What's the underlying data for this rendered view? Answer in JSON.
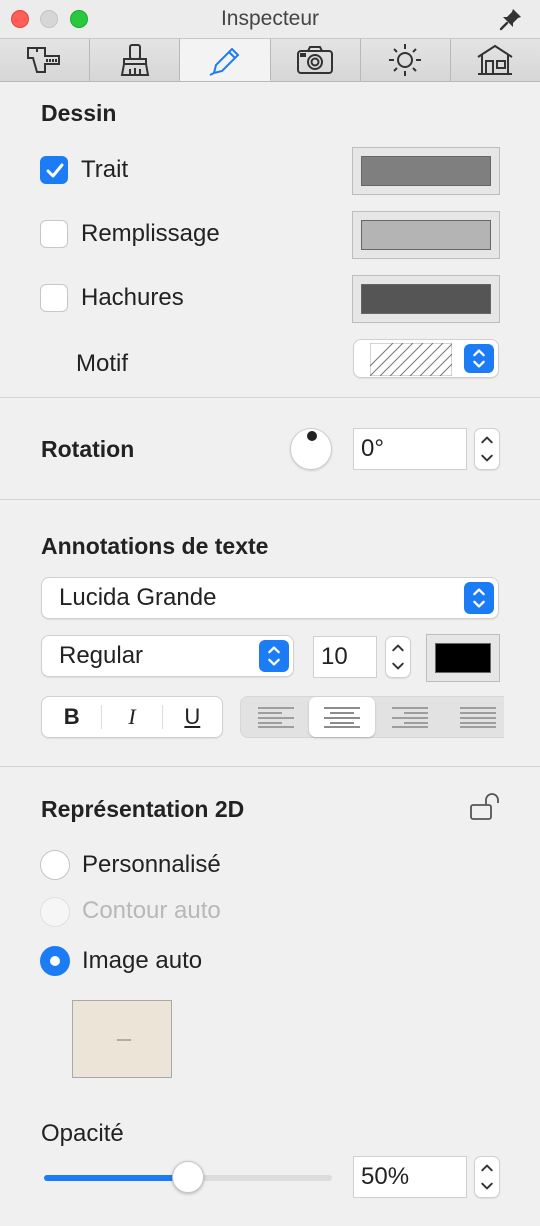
{
  "window": {
    "title": "Inspecteur"
  },
  "tabs": [
    {
      "icon": "caliper-icon",
      "active": false
    },
    {
      "icon": "brush-icon",
      "active": false
    },
    {
      "icon": "pencil-icon",
      "active": true
    },
    {
      "icon": "camera-icon",
      "active": false
    },
    {
      "icon": "sun-icon",
      "active": false
    },
    {
      "icon": "house-icon",
      "active": false
    }
  ],
  "drawing": {
    "title": "Dessin",
    "stroke": {
      "label": "Trait",
      "checked": true,
      "color": "#7f7f7f"
    },
    "fill": {
      "label": "Remplissage",
      "checked": false,
      "color": "#b4b4b4"
    },
    "hatch": {
      "label": "Hachures",
      "checked": false,
      "color": "#555555"
    },
    "pattern_label": "Motif"
  },
  "rotation": {
    "title": "Rotation",
    "value": "0°"
  },
  "text_annotations": {
    "title": "Annotations de texte",
    "font_family": "Lucida Grande",
    "font_style": "Regular",
    "font_size": "10",
    "text_color": "#000000",
    "bold_label": "B",
    "italic_label": "I",
    "underline_label": "U",
    "alignment": "center"
  },
  "representation_2d": {
    "title": "Représentation 2D",
    "locked": false,
    "options": [
      {
        "label": "Personnalisé",
        "selected": false,
        "enabled": true
      },
      {
        "label": "Contour auto",
        "selected": false,
        "enabled": false
      },
      {
        "label": "Image auto",
        "selected": true,
        "enabled": true
      }
    ]
  },
  "opacity": {
    "label": "Opacité",
    "value": "50%",
    "fraction": 0.5
  },
  "colors": {
    "accent": "#1b7cf5"
  }
}
